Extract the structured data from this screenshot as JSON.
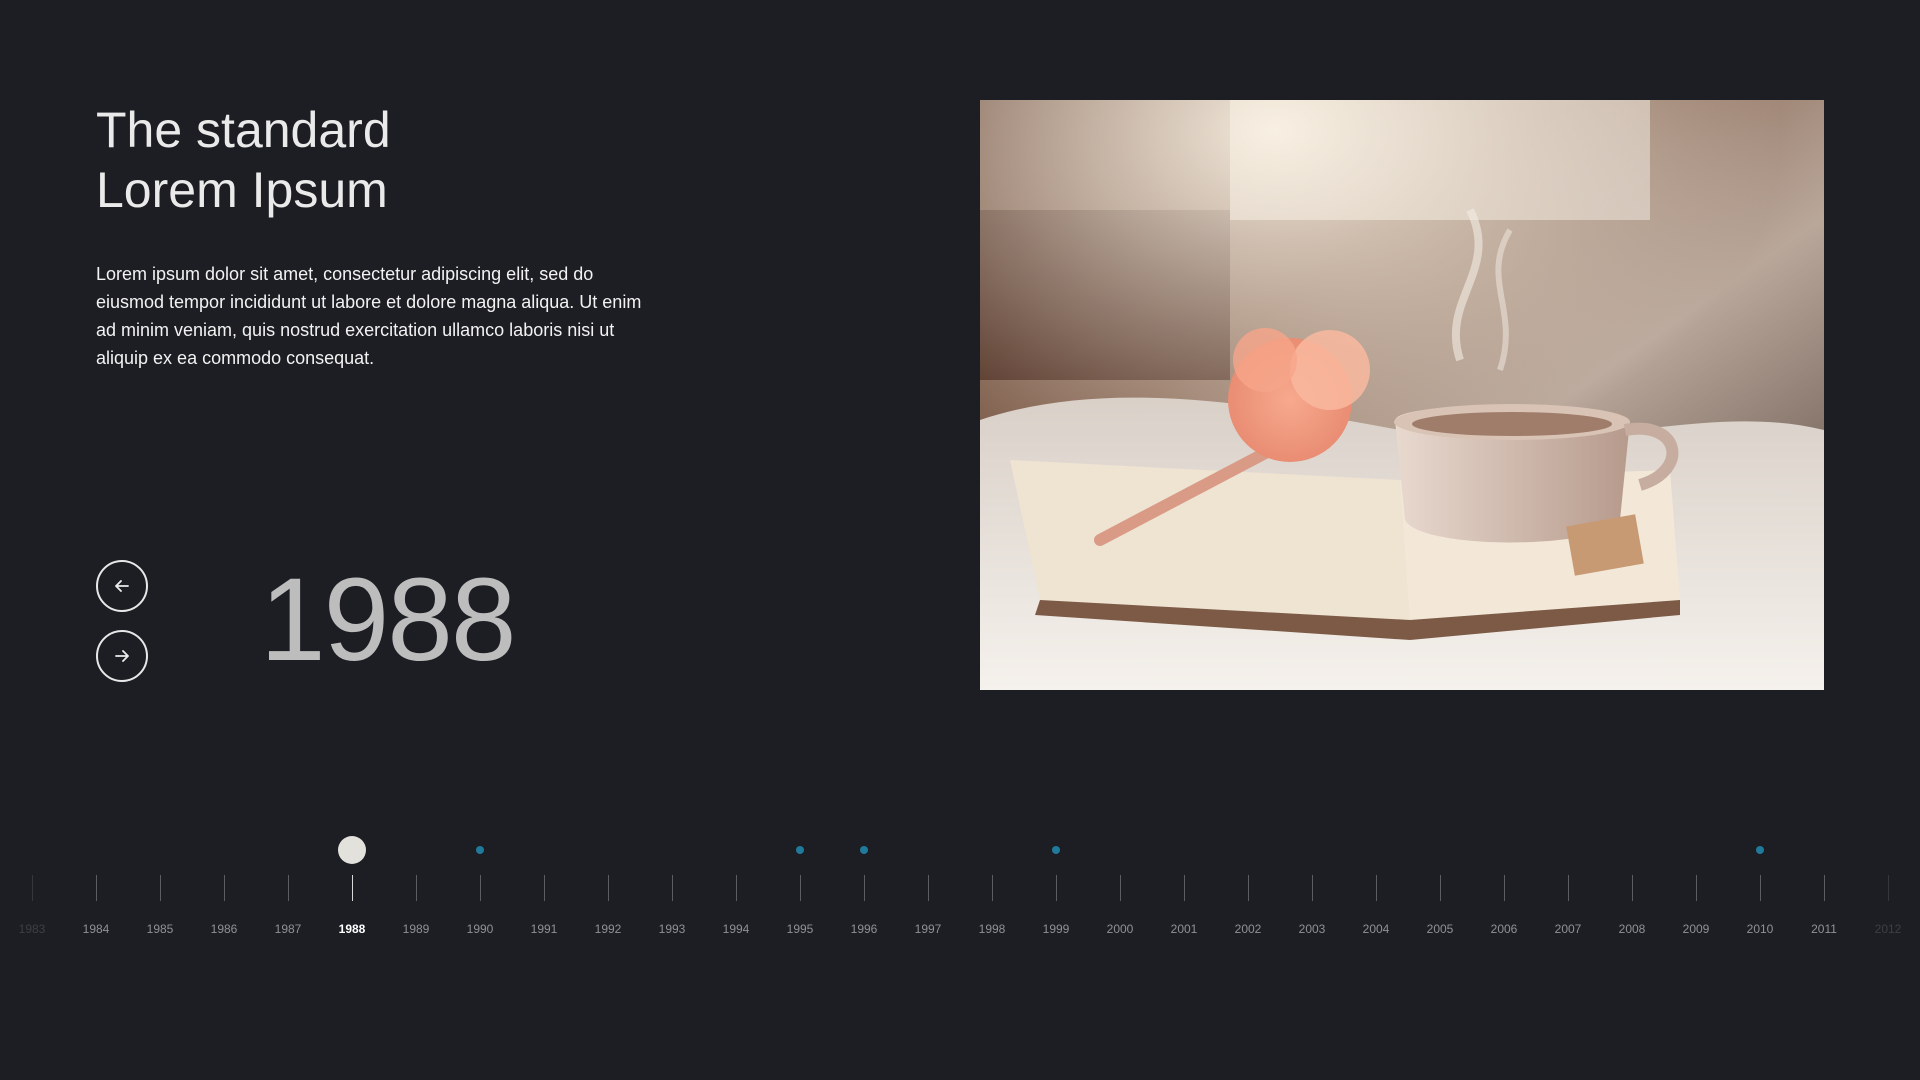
{
  "hero": {
    "title_line1": "The standard",
    "title_line2": "Lorem Ipsum",
    "description": "Lorem ipsum dolor sit amet, consectetur adipiscing elit, sed do eiusmod tempor incididunt ut labore et dolore magna aliqua. Ut enim ad minim veniam, quis nostrud exercitation ullamco laboris nisi ut aliquip ex ea commodo consequat.",
    "current_year": "1988"
  },
  "nav": {
    "prev_icon": "arrow-left-icon",
    "next_icon": "arrow-right-icon"
  },
  "photo": {
    "subject": "teacup with steam, pen with pink flower and open book on bed"
  },
  "timeline": {
    "active_year": "1988",
    "years": [
      "1983",
      "1984",
      "1985",
      "1986",
      "1987",
      "1988",
      "1989",
      "1990",
      "1991",
      "1992",
      "1993",
      "1994",
      "1995",
      "1996",
      "1997",
      "1998",
      "1999",
      "2000",
      "2001",
      "2002",
      "2003",
      "2004",
      "2005",
      "2006",
      "2007",
      "2008",
      "2009",
      "2010",
      "2011",
      "2012"
    ],
    "marked_years": [
      "1990",
      "1995",
      "1996",
      "1999",
      "2010"
    ],
    "faded_years": [
      "1983",
      "2012"
    ]
  },
  "colors": {
    "background": "#1c1e23",
    "marker_dot": "#1f7a9c",
    "active_dot": "#e3e1dc",
    "year_big": "#bdbdbd"
  }
}
